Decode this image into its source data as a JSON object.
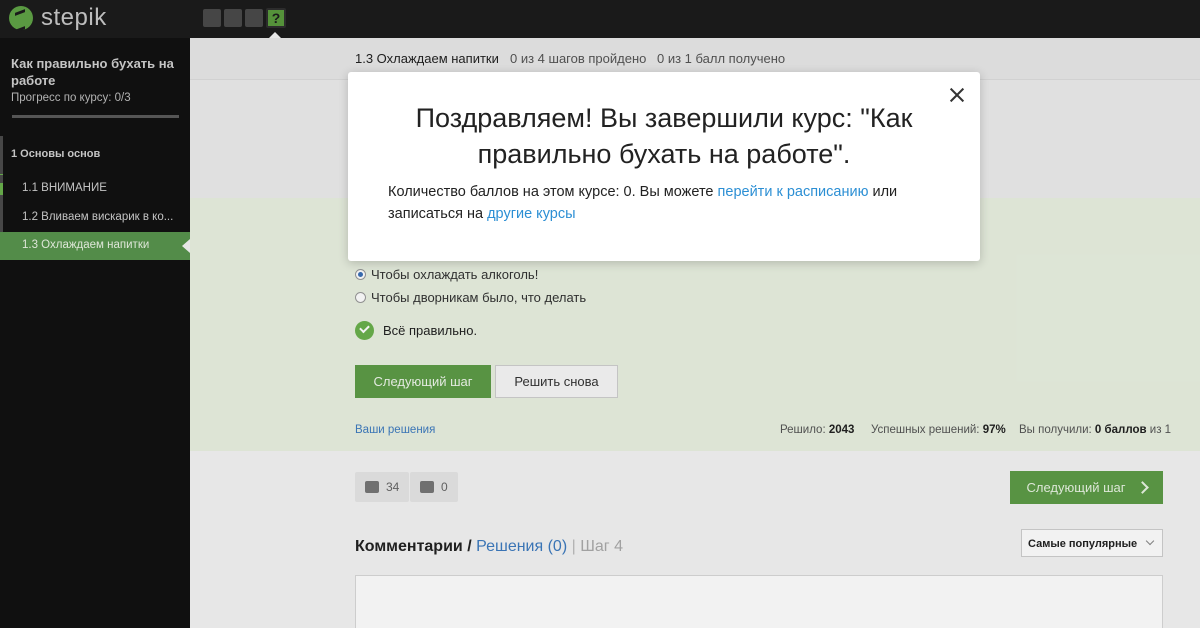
{
  "app": {
    "logo_text": "stepik"
  },
  "topbar": {
    "active_step_symbol": "?"
  },
  "sidebar": {
    "course_title": "Как правильно бухать на работе",
    "progress_label": "Прогресс по курсу:  0/3",
    "progress_fraction": 0.0,
    "section": {
      "label": "1  Основы основ"
    },
    "lessons": [
      {
        "label": "1.1  ВНИМАНИЕ"
      },
      {
        "label": "1.2  Вливаем вискарик в ко..."
      },
      {
        "label": "1.3  Охлаждаем напитки"
      }
    ]
  },
  "header": {
    "lesson_title": "1.3 Охлаждаем напитки",
    "steps_passed": "0 из 4 шагов пройдено",
    "points_received": "0 из 1 балл  получено"
  },
  "quiz": {
    "options": [
      {
        "label": "Чтобы охлаждать алкоголь!",
        "checked": true
      },
      {
        "label": "Чтобы дворникам было, что делать",
        "checked": false
      }
    ],
    "result_text": "Всё правильно.",
    "next_button": "Следующий шаг",
    "retry_button": "Решить снова",
    "your_solutions_link": "Ваши решения",
    "solved_label": "Решило:",
    "solved_value": "2043",
    "success_label": "Успешных решений:",
    "success_value": "97%",
    "you_got_label": "Вы получили:",
    "you_got_value": "0 баллов",
    "you_got_suffix": "из 1"
  },
  "feedback": {
    "likes": "34",
    "dislikes": "0",
    "next_step_button": "Следующий шаг"
  },
  "comments": {
    "title": "Комментарии",
    "slash": "/",
    "solutions_tab": "Решения (0)",
    "separator": "|",
    "step_label": "Шаг 4",
    "sort_value": "Самые популярные"
  },
  "modal": {
    "title": "Поздравляем! Вы завершили курс: \"Как правильно бухать на работе\".",
    "body_prefix": "Количество баллов на этом курсе: 0. Вы можете ",
    "link_schedule": "перейти к расписанию",
    "body_middle": " или записаться на ",
    "link_courses": "другие курсы"
  }
}
